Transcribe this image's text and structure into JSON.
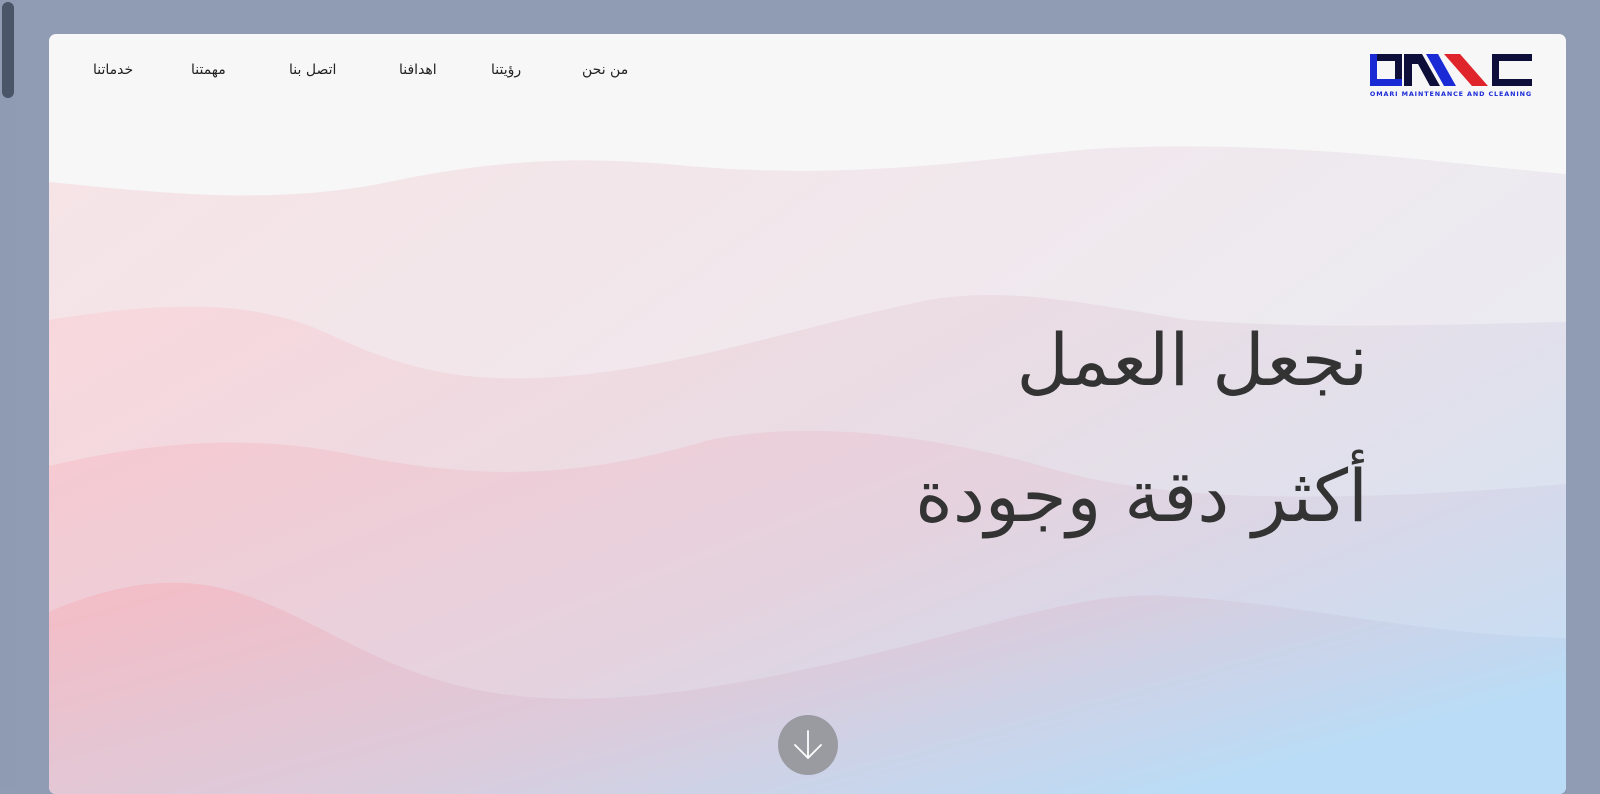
{
  "nav": {
    "items": [
      {
        "label": "من نحن"
      },
      {
        "label": "رؤيتنا"
      },
      {
        "label": "اهدافنا"
      },
      {
        "label": "اتصل بنا"
      },
      {
        "label": "مهمتنا"
      },
      {
        "label": "خدماتنا"
      }
    ]
  },
  "logo": {
    "tagline": "OMARI MAINTENANCE AND CLEANING",
    "colors": {
      "dark": "#0d0f3a",
      "blue": "#1a2bd6",
      "red": "#e0242b"
    }
  },
  "hero": {
    "line1": "نجعل العمل",
    "line2": "أكثر دقة وجودة"
  },
  "scroll_button": {
    "icon": "arrow-down-icon"
  },
  "colors": {
    "page_bg": "#8f9cb4",
    "frame_bg": "#f7f7f8",
    "wave_pink": "#f7c0c8",
    "wave_blue": "#b9dcf7"
  }
}
